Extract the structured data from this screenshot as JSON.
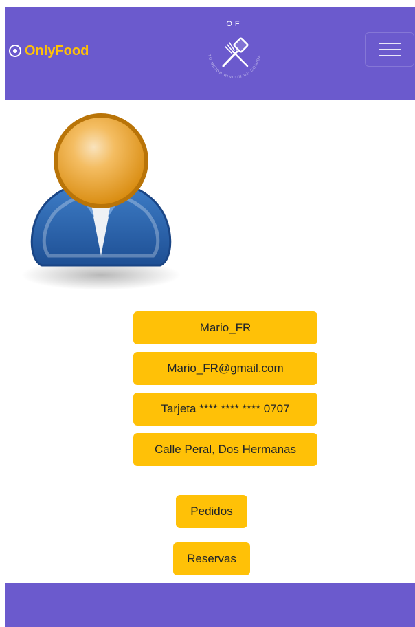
{
  "header": {
    "brand_name": "OnlyFood",
    "brand_icon": "circle-dot-icon",
    "logo": {
      "initials": "OF",
      "tagline": "TU MEJOR RINCON DE COMIDA",
      "icon": "spatula-fork-icon"
    },
    "menu_icon": "hamburger-menu-icon",
    "background_color": "#6b5acd",
    "brand_color": "#ffc107"
  },
  "profile": {
    "avatar_icon": "user-avatar-icon",
    "username": "Mario_FR",
    "email": "Mario_FR@gmail.com",
    "card": "Tarjeta **** **** **** 0707",
    "address": "Calle Peral, Dos Hermanas",
    "pill_color": "#ffc107"
  },
  "actions": {
    "orders_label": "Pedidos",
    "reservations_label": "Reservas"
  },
  "footer": {
    "background_color": "#6b5acd"
  }
}
